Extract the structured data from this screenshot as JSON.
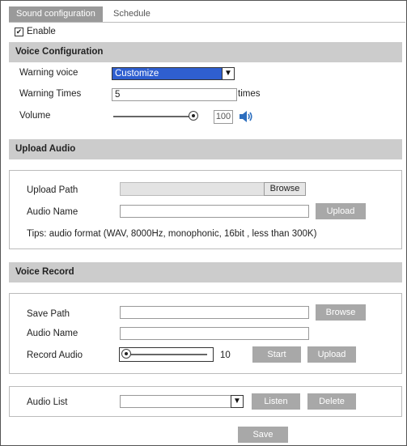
{
  "tabs": [
    "Sound configuration",
    "Schedule"
  ],
  "enable": {
    "label": "Enable",
    "checked_glyph": "✔"
  },
  "voice_config": {
    "title": "Voice Configuration",
    "warning_voice_label": "Warning voice",
    "warning_voice_value": "Customize",
    "warning_times_label": "Warning Times",
    "warning_times_value": "5",
    "times_unit": "times",
    "volume_label": "Volume",
    "volume_value": "100",
    "speaker_icon": "speaker-icon"
  },
  "upload_audio": {
    "title": "Upload Audio",
    "upload_path_label": "Upload Path",
    "browse_label": "Browse",
    "audio_name_label": "Audio Name",
    "upload_label": "Upload",
    "tips": "Tips: audio format (WAV, 8000Hz, monophonic, 16bit , less than 300K)"
  },
  "voice_record": {
    "title": "Voice Record",
    "save_path_label": "Save Path",
    "browse_label": "Browse",
    "audio_name_label": "Audio Name",
    "record_audio_label": "Record Audio",
    "record_value": "10",
    "start_label": "Start",
    "upload_label": "Upload"
  },
  "audio_list": {
    "label": "Audio List",
    "listen_label": "Listen",
    "delete_label": "Delete"
  },
  "save_label": "Save",
  "colors": {
    "section_bg": "#cccccc",
    "button_bg": "#a8a8a8",
    "select_blue": "#2f5fd0",
    "speaker_blue": "#2d6fbf"
  }
}
